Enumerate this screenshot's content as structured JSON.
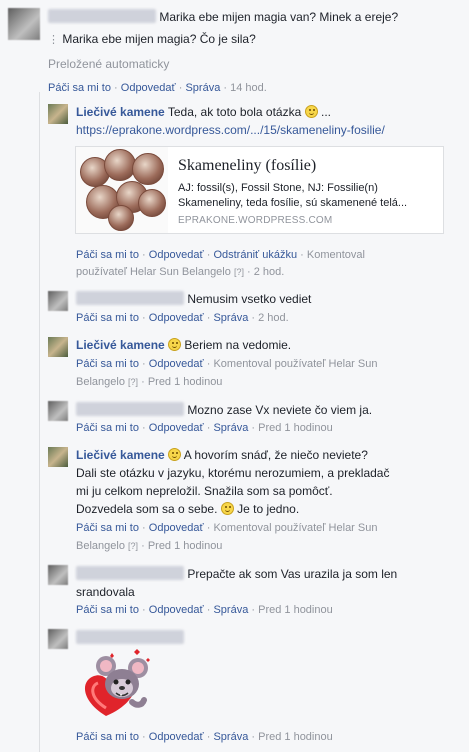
{
  "comments": [
    {
      "id": "c0",
      "author_blurred": true,
      "text": "Marika ebe mijen magia van? Minek a ereje?",
      "translation": "Marika ebe mijen magia? Čo je sila?",
      "translated_note": "Preložené automaticky",
      "actions": [
        "Páči sa mi to",
        "Odpovedať",
        "Správa"
      ],
      "time": "14 hod."
    },
    {
      "id": "c1",
      "author": "Liečivé kamene",
      "text": "Teda, ak toto bola otázka",
      "text_suffix": "...",
      "link": "https://eprakone.wordpress.com/.../15/skameneliny-fosilie/",
      "card": {
        "title": "Skameneliny (fosílie)",
        "desc1": "AJ: fossil(s), Fossil Stone, NJ: Fossilie(n)",
        "desc2": "Skameneliny, teda fosílie, sú skamenené telá...",
        "domain": "EPRAKONE.WORDPRESS.COM"
      },
      "actions": [
        "Páči sa mi to",
        "Odpovedať",
        "Odstrániť ukážku"
      ],
      "commented_by": "Komentoval",
      "commented_by2": "používateľ Helar Sun Belangelo",
      "q": "[?]",
      "time": "2 hod."
    },
    {
      "id": "c2",
      "author_blurred": true,
      "text": "Nemusim vsetko vediet",
      "actions": [
        "Páči sa mi to",
        "Odpovedať",
        "Správa"
      ],
      "time": "2 hod."
    },
    {
      "id": "c3",
      "author": "Liečivé kamene",
      "text": "Beriem na vedomie.",
      "actions": [
        "Páči sa mi to",
        "Odpovedať"
      ],
      "commented_by": "Komentoval používateľ Helar Sun",
      "commented_by2": "Belangelo",
      "q": "[?]",
      "time": "Pred 1 hodinou"
    },
    {
      "id": "c4",
      "author_blurred": true,
      "text": "Mozno zase Vx neviete čo viem ja.",
      "actions": [
        "Páči sa mi to",
        "Odpovedať",
        "Správa"
      ],
      "time": "Pred 1 hodinou"
    },
    {
      "id": "c5",
      "author": "Liečivé kamene",
      "line1": "A hovorím snáď, že niečo neviete?",
      "line2": "Dali ste otázku v jazyku, ktorému nerozumiem, a prekladač",
      "line3": "mi ju celkom nepreložil. Snažila som sa pomôcť.",
      "line4a": "Dozvedela som sa o sebe.",
      "line4b": "Je to jedno.",
      "actions": [
        "Páči sa mi to",
        "Odpovedať"
      ],
      "commented_by": "Komentoval používateľ Helar Sun",
      "commented_by2": "Belangelo",
      "q": "[?]",
      "time": "Pred 1 hodinou"
    },
    {
      "id": "c6",
      "author_blurred": true,
      "text": "Prepačte ak som Vas urazila ja som len",
      "text2": "srandovala",
      "actions": [
        "Páči sa mi to",
        "Odpovedať",
        "Správa"
      ],
      "time": "Pred 1 hodinou"
    },
    {
      "id": "c7",
      "author_blurred": true,
      "sticker": "mouse-heart-sticker",
      "actions": [
        "Páči sa mi to",
        "Odpovedať",
        "Správa"
      ],
      "time": "Pred 1 hodinou"
    }
  ],
  "sep": "·",
  "colors": {
    "link": "#365899",
    "meta": "#90949c",
    "background": "#f6f7f9"
  }
}
